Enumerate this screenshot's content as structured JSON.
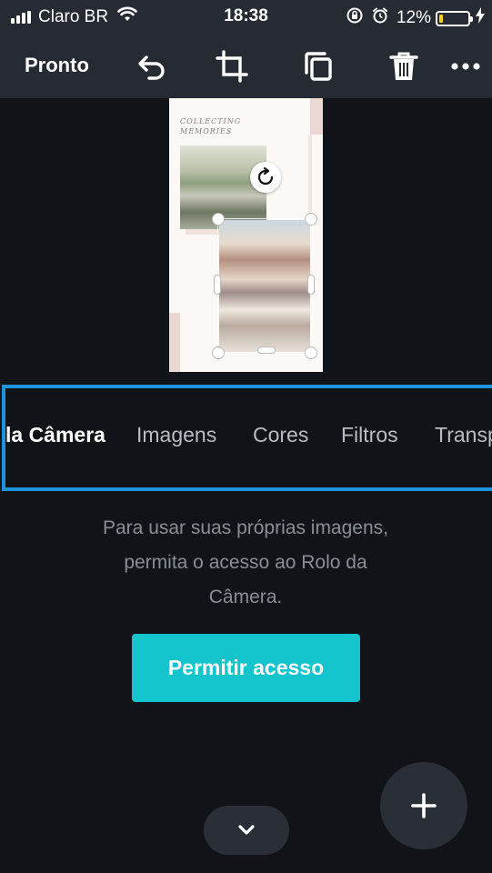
{
  "status_bar": {
    "carrier": "Claro BR",
    "time": "18:38",
    "battery_percent": "12%",
    "battery_level": 0.12,
    "icons": [
      "signal-icon",
      "wifi-icon",
      "orientation-lock-icon",
      "alarm-icon",
      "battery-icon",
      "charging-icon"
    ]
  },
  "toolbar": {
    "done_label": "Pronto",
    "icons": [
      "undo-icon",
      "crop-icon",
      "duplicate-icon",
      "trash-icon",
      "more-icon"
    ]
  },
  "canvas": {
    "heading_line1": "COLLECTING",
    "heading_line2": "MEMORIES"
  },
  "tabs": {
    "items": [
      {
        "label": "la Câmera",
        "active": true
      },
      {
        "label": "Imagens",
        "active": false
      },
      {
        "label": "Cores",
        "active": false
      },
      {
        "label": "Filtros",
        "active": false
      },
      {
        "label": "Transp",
        "active": false
      }
    ],
    "border_color": "#1d93dd"
  },
  "permission": {
    "line1": "Para usar suas próprias imagens,",
    "line2": "permita o acesso ao Rolo da",
    "line3": "Câmera.",
    "button_label": "Permitir acesso",
    "button_color": "#13c4cd"
  },
  "controls": {
    "collapse_icon": "chevron-down-icon",
    "fab_icon": "plus-icon"
  }
}
